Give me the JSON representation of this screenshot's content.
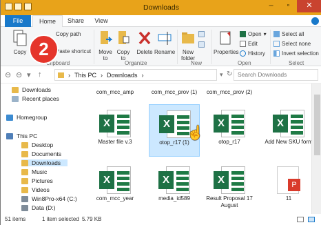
{
  "window": {
    "title": "Downloads"
  },
  "tabs": {
    "file": "File",
    "home": "Home",
    "share": "Share",
    "view": "View"
  },
  "ribbon": {
    "clipboard": {
      "group": "Clipboard",
      "copy": "Copy",
      "copy_path": "Copy path",
      "paste_shortcut": "Paste shortcut"
    },
    "organize": {
      "group": "Organize",
      "move_to": "Move to",
      "copy_to": "Copy to",
      "delete": "Delete",
      "rename": "Rename"
    },
    "new": {
      "group": "New",
      "new_folder": "New folder"
    },
    "open": {
      "group": "Open",
      "properties": "Properties",
      "open": "Open",
      "edit": "Edit",
      "history": "History"
    },
    "select": {
      "group": "Select",
      "select_all": "Select all",
      "select_none": "Select none",
      "invert": "Invert selection"
    }
  },
  "step_badge": "2",
  "address": {
    "segments": [
      "This PC",
      "Downloads"
    ],
    "search_placeholder": "Search Downloads"
  },
  "nav": [
    {
      "label": "Downloads",
      "type": "folder"
    },
    {
      "label": "Recent places",
      "type": "recent"
    },
    {
      "label": "Homegroup",
      "type": "homegroup"
    },
    {
      "label": "This PC",
      "type": "pc"
    },
    {
      "label": "Desktop",
      "type": "folder"
    },
    {
      "label": "Documents",
      "type": "folder"
    },
    {
      "label": "Downloads",
      "type": "folder",
      "selected": true
    },
    {
      "label": "Music",
      "type": "folder"
    },
    {
      "label": "Pictures",
      "type": "folder"
    },
    {
      "label": "Videos",
      "type": "folder"
    },
    {
      "label": "Win8Pro-x64 (C:)",
      "type": "drive"
    },
    {
      "label": "Data (D:)",
      "type": "drive"
    }
  ],
  "files": [
    {
      "name": "com_mcc_amp",
      "icon": "excel"
    },
    {
      "name": "com_mcc_prov (1)",
      "icon": "excel"
    },
    {
      "name": "com_mcc_prov (2)",
      "icon": "excel"
    },
    {
      "name": "",
      "icon": "excel"
    },
    {
      "name": "Master file v.3",
      "icon": "excel"
    },
    {
      "name": "otop_r17 (1)",
      "icon": "excel",
      "selected": true
    },
    {
      "name": "otop_r17",
      "icon": "excel"
    },
    {
      "name": "Add New SKU form",
      "icon": "excel"
    },
    {
      "name": "com_mcc_year",
      "icon": "excel"
    },
    {
      "name": "media_id589",
      "icon": "excel"
    },
    {
      "name": "Result Proposal 17 August",
      "icon": "excel"
    },
    {
      "name": "11",
      "icon": "pdf"
    }
  ],
  "status": {
    "items": "51 items",
    "selected": "1 item selected",
    "size": "5.79 KB"
  },
  "colors": {
    "titlebar": "#e8a31a",
    "file_tab": "#1979ca",
    "badge": "#e5352b",
    "excel": "#1e7145",
    "selection": "#cce8ff"
  }
}
